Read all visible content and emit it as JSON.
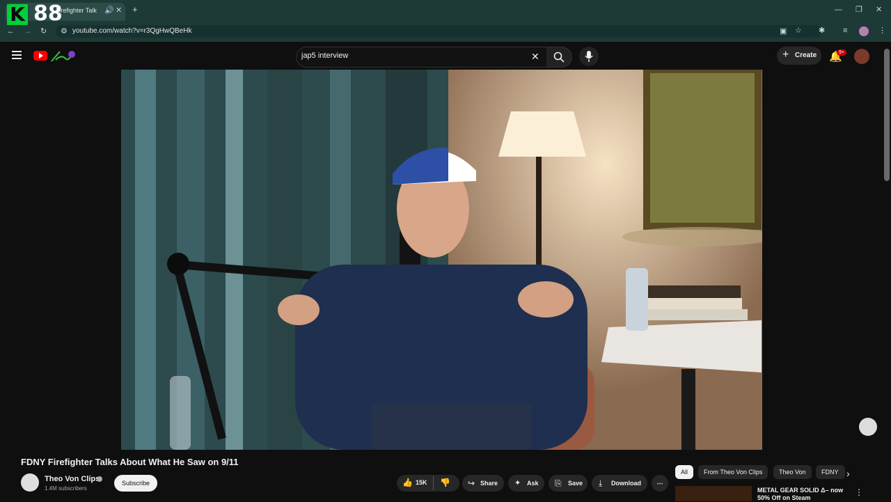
{
  "browser": {
    "logo_letter": "K",
    "logo_number": "88",
    "tab_title": "Firefighter Talk",
    "url": "youtube.com/watch?v=r3QgHwQBeHk",
    "icons": [
      "back-icon",
      "forward-icon",
      "reload-icon",
      "site-info-icon",
      "install-icon",
      "bookmark-star-icon",
      "extensions-icon",
      "media-icon",
      "profile-icon",
      "menu-kebab-icon",
      "minimize-icon",
      "maximize-icon",
      "close-icon"
    ]
  },
  "youtube": {
    "search_query": "jap5 interview",
    "create_label": "Create",
    "notification_count": "9+"
  },
  "video": {
    "title": "FDNY Firefighter Talks About What He Saw on 9/11",
    "channel": "Theo Von Clips",
    "subscribers": "1.4M subscribers",
    "subscribe_label": "Subscribe",
    "likes": "15K",
    "share_label": "Share",
    "ask_label": "Ask",
    "save_label": "Save",
    "download_label": "Download"
  },
  "chips": [
    "All",
    "From Theo Von Clips",
    "Theo Von",
    "FDNY"
  ],
  "recommendation": {
    "title": "METAL GEAR SOLID Δ– now 50% Off on Steam"
  },
  "colors": {
    "chrome_bg": "#1e3a37",
    "yt_bg": "#0f0f0f",
    "brand_red": "#ff0000",
    "k_green": "#00d03a"
  }
}
